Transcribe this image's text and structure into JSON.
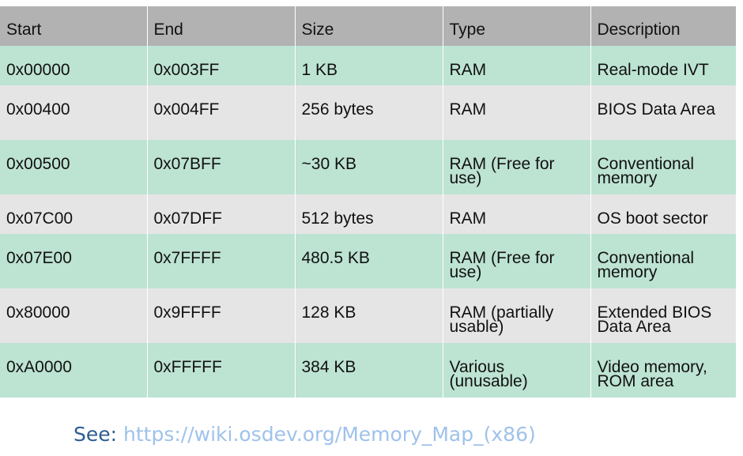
{
  "columns": [
    "Start",
    "End",
    "Size",
    "Type",
    "Description"
  ],
  "rows": [
    {
      "start": "0x00000",
      "end": "0x003FF",
      "size": "1 KB",
      "type": "RAM",
      "description": "Real-mode IVT"
    },
    {
      "start": "0x00400",
      "end": "0x004FF",
      "size": "256 bytes",
      "type": "RAM",
      "description": "BIOS Data Area"
    },
    {
      "start": "0x00500",
      "end": "0x07BFF",
      "size": "~30 KB",
      "type": "RAM (Free for use)",
      "description": "Conventional memory"
    },
    {
      "start": "0x07C00",
      "end": "0x07DFF",
      "size": "512 bytes",
      "type": "RAM",
      "description": "OS boot sector"
    },
    {
      "start": "0x07E00",
      "end": "0x7FFFF",
      "size": "480.5 KB",
      "type": "RAM (Free for use)",
      "description": "Conventional memory"
    },
    {
      "start": "0x80000",
      "end": "0x9FFFF",
      "size": "128 KB",
      "type": "RAM (partially usable)",
      "description": "Extended BIOS Data Area"
    },
    {
      "start": "0xA0000",
      "end": "0xFFFFF",
      "size": "384 KB",
      "type": "Various (unusable)",
      "description": "Video memory, ROM area"
    }
  ],
  "footer": {
    "prefix": "See:",
    "url": "https://wiki.osdev.org/Memory_Map_(x86)"
  },
  "colors": {
    "header_bg": "#b2b2b2",
    "row_green": "#bde3d3",
    "row_gray": "#e5e5e5",
    "see_text": "#2b5d91",
    "link": "#9fc2ea"
  }
}
